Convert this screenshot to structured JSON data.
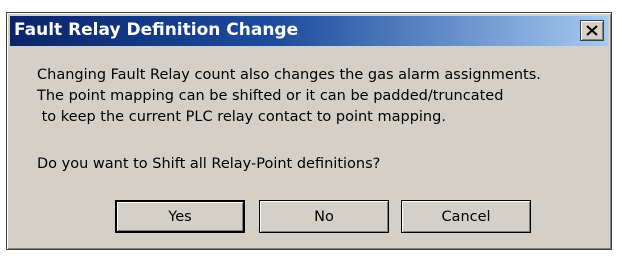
{
  "dialog": {
    "title": "Fault Relay Definition Change",
    "close_symbol": "x",
    "message_lines": [
      "Changing Fault Relay count also changes the gas alarm assignments.",
      "The point mapping can be shifted or it can be padded/truncated",
      " to keep the current PLC relay contact to point mapping."
    ],
    "question": "Do you want to Shift all Relay-Point definitions?",
    "buttons": {
      "yes_label": "Yes",
      "no_label": "No",
      "cancel_label": "Cancel"
    }
  },
  "colors": {
    "titlebar_start": "#0a246a",
    "titlebar_end": "#a6caf0",
    "dialog_face": "#d4d0c8"
  }
}
